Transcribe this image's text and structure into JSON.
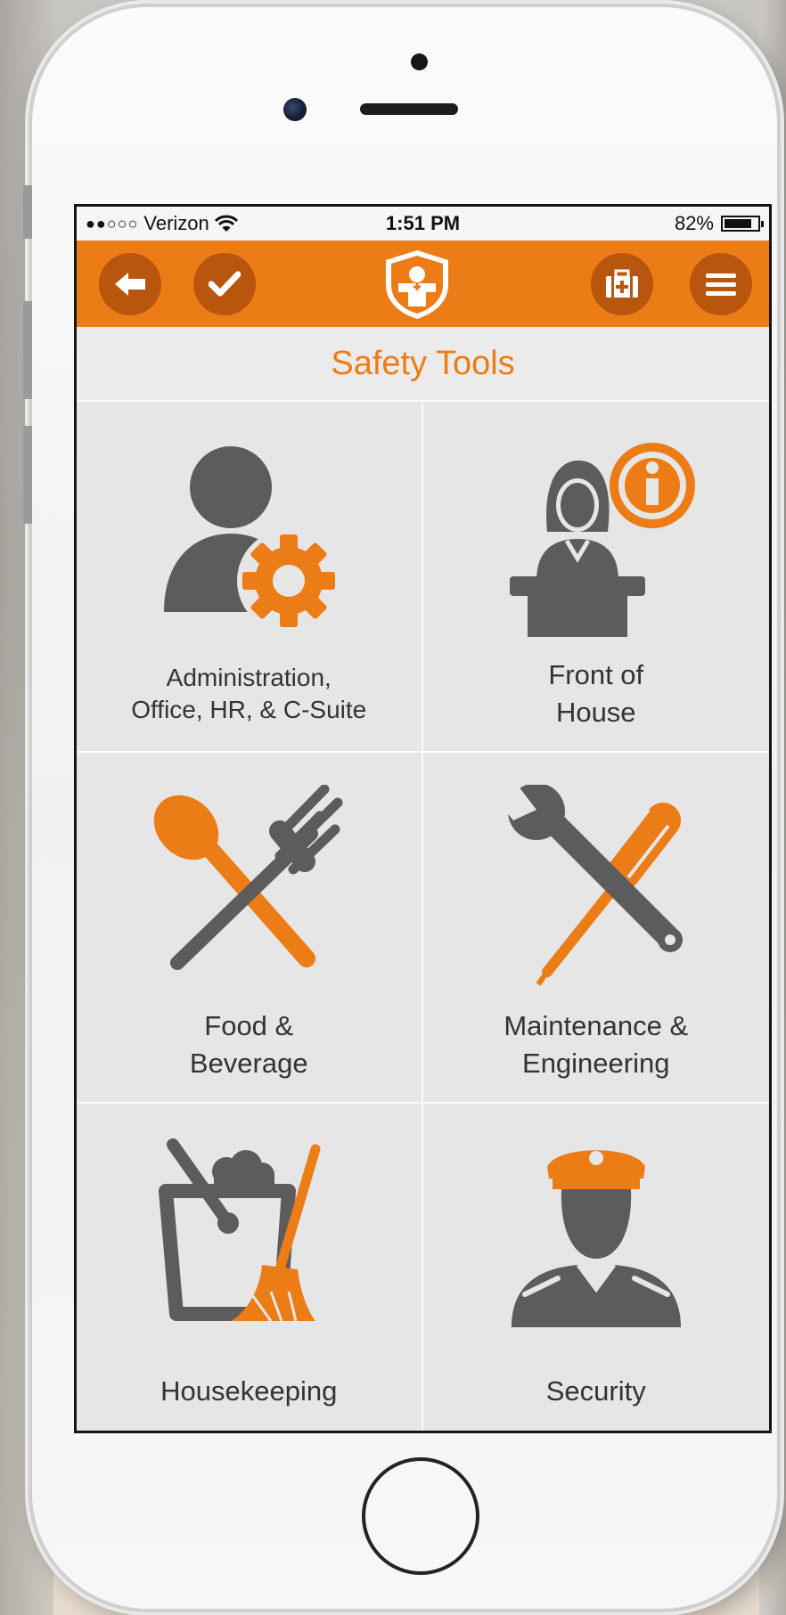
{
  "status_bar": {
    "carrier": "Verizon",
    "signal_dots": "●●○○○",
    "time": "1:51 PM",
    "battery": "82%"
  },
  "header": {
    "back_icon": "arrow-left-icon",
    "check_icon": "checkmark-icon",
    "logo_icon": "shield-cross-logo-icon",
    "firstaid_icon": "first-aid-kit-icon",
    "menu_icon": "hamburger-menu-icon"
  },
  "page": {
    "title": "Safety Tools"
  },
  "tiles": [
    {
      "label": "Administration,\nOffice, HR, & C-Suite",
      "icon": "admin-person-gear-icon"
    },
    {
      "label": "Front of\nHouse",
      "icon": "front-desk-info-icon"
    },
    {
      "label": "Food &\nBeverage",
      "icon": "spoon-fork-icon"
    },
    {
      "label": "Maintenance &\nEngineering",
      "icon": "wrench-screwdriver-icon"
    },
    {
      "label": "Housekeeping",
      "icon": "bucket-broom-icon"
    },
    {
      "label": "Security",
      "icon": "security-guard-icon"
    }
  ],
  "colors": {
    "accent": "#ec7c15",
    "accent_dark": "#b9560d",
    "icon_gray": "#5c5c5c",
    "tile_bg": "#e6e6e6"
  }
}
